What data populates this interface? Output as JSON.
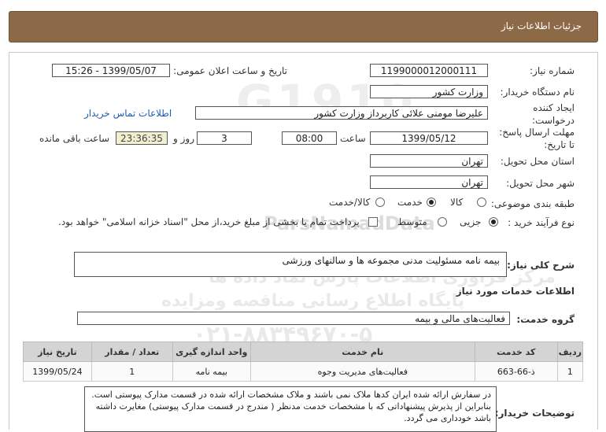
{
  "header": {
    "title": "جزئیات اطلاعات نیاز"
  },
  "fields": {
    "need_number_label": "شماره نیاز:",
    "need_number": "1199000012000111",
    "announce_label": "تاریخ و ساعت اعلان عمومی:",
    "announce_value": "1399/05/07 - 15:26",
    "buyer_org_label": "نام دستگاه خریدار:",
    "buyer_org": "وزارت کشور",
    "requester_label_1": "ایجاد کننده",
    "requester_label_2": "درخواست:",
    "requester": "علیرضا مومنی علائی کاربرداز وزارت کشور",
    "contact_link": "اطلاعات تماس خریدار",
    "deadline_label_1": "مهلت ارسال پاسخ:",
    "deadline_label_2": "تا تاریخ:",
    "deadline_date": "1399/05/12",
    "time_label": "ساعت",
    "deadline_time": "08:00",
    "days_value": "3",
    "days_label": "روز و",
    "remaining_time": "23:36:35",
    "remaining_label": "ساعت باقی مانده",
    "province_label": "استان محل تحویل:",
    "province": "تهران",
    "city_label": "شهر محل تحویل:",
    "city": "تهران",
    "category_label": "طبقه بندی موضوعی:",
    "category_options": [
      "کالا",
      "خدمت",
      "کالا/خدمت"
    ],
    "category_selected": "خدمت",
    "process_label": "نوع فرآیند خرید :",
    "process_options": [
      "جزیی",
      "متوسط"
    ],
    "process_selected": "جزیی",
    "payment_note": "پرداخت تمام یا بخشی از مبلغ خرید،از محل \"اسناد خزانه اسلامی\" خواهد بود."
  },
  "summary": {
    "label": "شرح کلی نیاز:",
    "value": "بیمه نامه مسئولیت مدنی مجموعه ها و سالنهای ورزشی"
  },
  "services": {
    "section_title": "اطلاعات خدمات مورد نیاز",
    "group_label": "گروه خدمت:",
    "group_value": "فعالیت‌های مالی و بیمه",
    "columns": [
      "ردیف",
      "کد خدمت",
      "نام خدمت",
      "واحد اندازه گیری",
      "تعداد / مقدار",
      "تاریخ نیاز"
    ],
    "rows": [
      [
        "1",
        "ذ-66-663",
        "فعالیت‌های مدیریت وجوه",
        "بیمه نامه",
        "1",
        "1399/05/24"
      ]
    ]
  },
  "buyer_notes": {
    "label": "توضیحات خریدار:",
    "text": "در سفارش ارائه شده ایران کدها ملاک نمی باشند و ملاک مشخصات ارائه شده در قسمت مدارک پیوستی است. بنابراین از پذیرش پیشنهاداتی که با مشخصات خدمت مدنظر ( مندرج در قسمت مدارک پیوستی) مغایرت داشته باشد خودداری می گردد."
  },
  "watermark": {
    "brand": "ParsNamadData",
    "line1": "مرکز فراوری اطلاعات پارس نماد داده ها",
    "line2": "پایگاه اطلاع رسانی مناقصه ومزایده",
    "phone": "۰۲۱-۸۸۳۴۹۶۷۰-۵"
  }
}
